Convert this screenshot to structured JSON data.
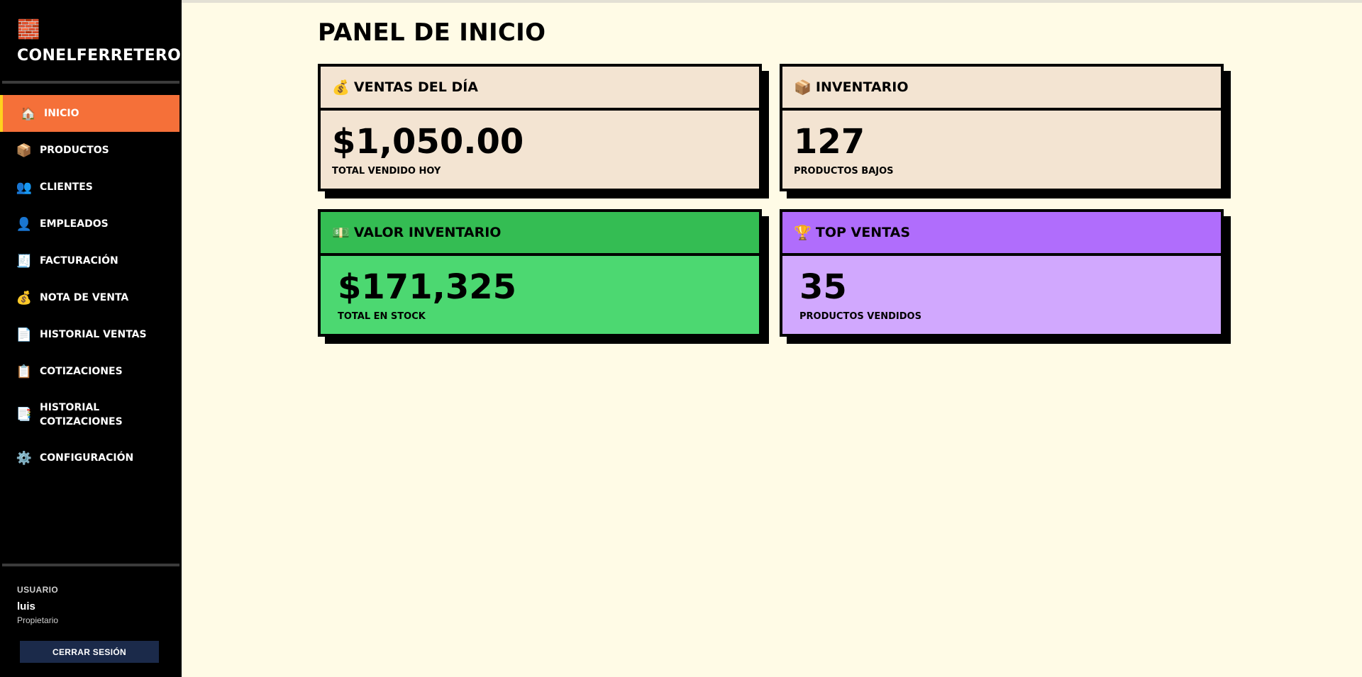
{
  "brand": {
    "icon": "brick-icon",
    "name": "CONELFERRETERO"
  },
  "nav": [
    {
      "label": "INICIO",
      "icon": "🏠",
      "active": true
    },
    {
      "label": "PRODUCTOS",
      "icon": "📦"
    },
    {
      "label": "CLIENTES",
      "icon": "👥"
    },
    {
      "label": "EMPLEADOS",
      "icon": "👤"
    },
    {
      "label": "FACTURACIÓN",
      "icon": "🧾"
    },
    {
      "label": "NOTA DE VENTA",
      "icon": "💰"
    },
    {
      "label": "HISTORIAL VENTAS",
      "icon": "📄"
    },
    {
      "label": "COTIZACIONES",
      "icon": "📋"
    },
    {
      "label": "HISTORIAL COTIZACIONES",
      "icon": "📑"
    },
    {
      "label": "CONFIGURACIÓN",
      "icon": "⚙️"
    }
  ],
  "user": {
    "label": "USUARIO",
    "name": "luis",
    "role": "Propietario",
    "logout": "CERRAR SESIÓN"
  },
  "page": {
    "title": "PANEL DE INICIO"
  },
  "cards": {
    "ventas": {
      "icon": "💰",
      "title": "VENTAS DEL DÍA",
      "value": "$1,050.00",
      "subtitle": "TOTAL VENDIDO HOY"
    },
    "inventario": {
      "icon": "📦",
      "title": "INVENTARIO",
      "value": "127",
      "subtitle": "PRODUCTOS BAJOS"
    },
    "valor": {
      "icon": "💵",
      "title": "VALOR INVENTARIO",
      "value": "$171,325",
      "subtitle": "TOTAL EN STOCK"
    },
    "top": {
      "icon": "🏆",
      "title": "TOP VENTAS",
      "value": "35",
      "subtitle": "PRODUCTOS VENDIDOS"
    }
  },
  "colors": {
    "accent": "#f57039",
    "green": "#4cd871",
    "purple": "#d1a8fe",
    "beige": "#f3e4d2",
    "background": "#fffbe6"
  }
}
